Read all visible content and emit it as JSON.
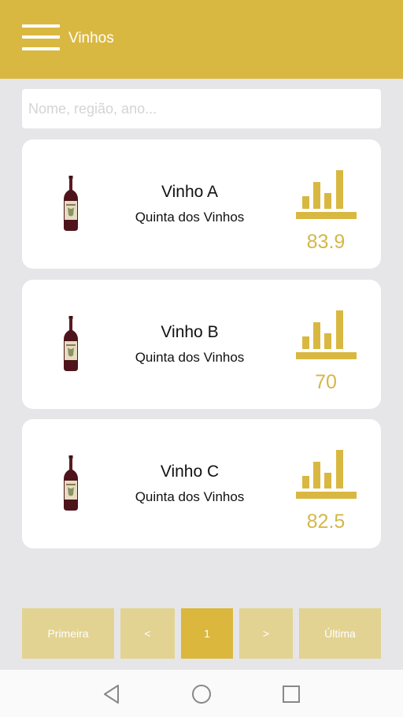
{
  "header": {
    "title": "Vinhos",
    "menu_icon": "hamburger-menu-icon"
  },
  "search": {
    "placeholder": "Nome, região, ano..."
  },
  "wines": [
    {
      "name": "Vinho A",
      "producer": "Quinta dos Vinhos",
      "score": "83.9"
    },
    {
      "name": "Vinho B",
      "producer": "Quinta dos Vinhos",
      "score": "70"
    },
    {
      "name": "Vinho C",
      "producer": "Quinta dos Vinhos",
      "score": "82.5"
    }
  ],
  "pagination": {
    "first": "Primeira",
    "prev": "<",
    "current": "1",
    "next": ">",
    "last": "Última"
  },
  "system_nav": {
    "icons": [
      "back-icon",
      "home-icon",
      "recents-icon"
    ]
  },
  "colors": {
    "accent": "#d9b842",
    "score": "#d5b747",
    "pager_inactive": "#e2d392",
    "background": "#e6e6e8"
  }
}
